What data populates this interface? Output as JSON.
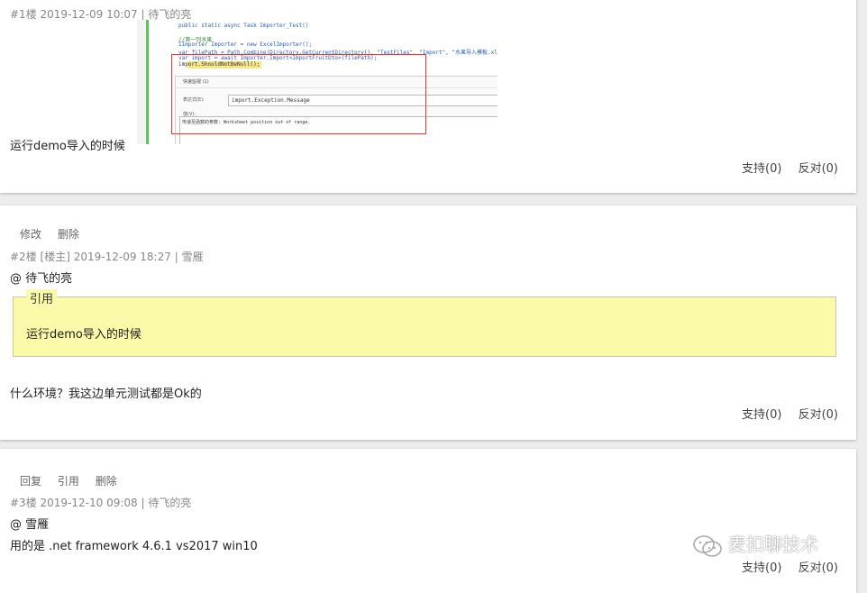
{
  "posts": [
    {
      "meta_floor": "#1楼",
      "meta_date": "2019-12-09 10:07",
      "meta_sep": "|",
      "meta_author": "待飞的亮",
      "body_text": "运行demo导入的时候",
      "screenshot": {
        "code_lines": [
          "public static async Task Importer_Test()",
          "//第一列水果",
          "IImporter Importer = new ExcelImporter();",
          "var filePath = Path.Combine(Directory.GetCurrentDirectory(), \"TestFiles\", \"Import\", \"水果导入模板.xlsx\");",
          "var import = await Importer.Import<ImportFruitDto>(filePath);",
          "import.ShouldNotBeNull();"
        ],
        "dialog_title": "快速监视 (1)",
        "dialog_field_label": "表达式(E):",
        "dialog_field_value": "import.Exception.Message",
        "dialog_value_label": "值(V):",
        "dialog_value_text": "传递至函数的参数: Worksheet position out of range."
      },
      "votes": {
        "support": "支持(0)",
        "oppose": "反对(0)"
      }
    },
    {
      "actions": [
        "修改",
        "删除"
      ],
      "meta_floor": "#2楼",
      "meta_tag": "[楼主]",
      "meta_date": "2019-12-09 18:27",
      "meta_sep": "|",
      "meta_author": "雪雁",
      "mention": "@ 待飞的亮",
      "quote_legend": "引用",
      "quote_text": "运行demo导入的时候",
      "body_text": "什么环境？我这边单元测试都是Ok的",
      "votes": {
        "support": "支持(0)",
        "oppose": "反对(0)"
      }
    },
    {
      "actions": [
        "回复",
        "引用",
        "删除"
      ],
      "meta_floor": "#3楼",
      "meta_date": "2019-12-10 09:08",
      "meta_sep": "|",
      "meta_author": "待飞的亮",
      "mention": "@ 雪雁",
      "body_text": "用的是 .net framework 4.6.1 vs2017 win10",
      "votes": {
        "support": "支持(0)",
        "oppose": "反对(0)"
      }
    }
  ],
  "watermark": {
    "text": "麦扣聊技术",
    "icon": "wechat-icon"
  }
}
